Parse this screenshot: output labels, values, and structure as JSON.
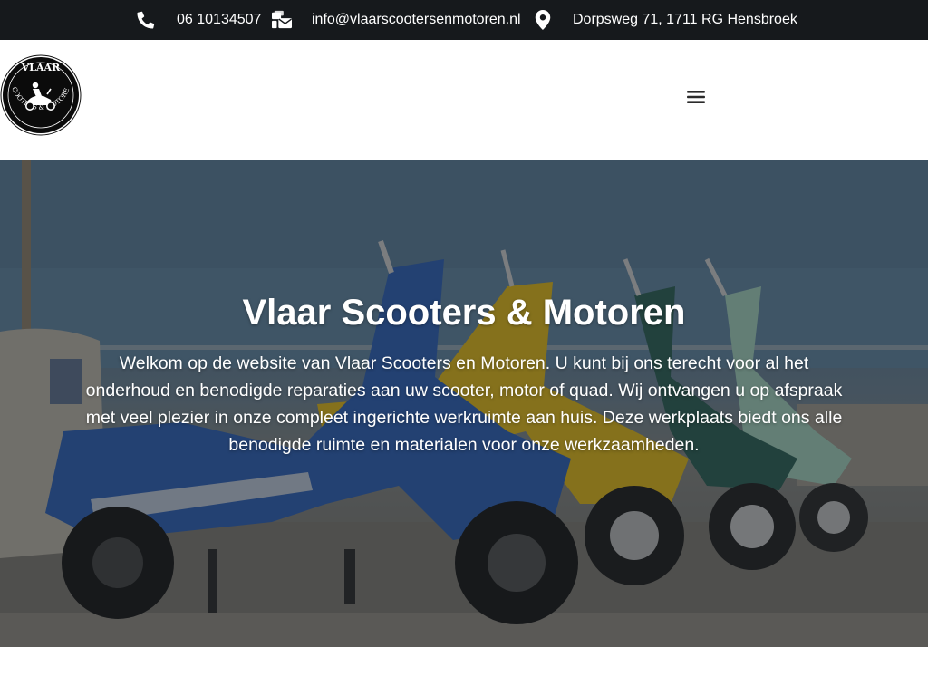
{
  "topbar": {
    "phone": {
      "icon": "phone-icon",
      "text": "06 10134507"
    },
    "email": {
      "icon": "mail-bulk-icon",
      "text": "info@vlaarscootersenmotoren.nl"
    },
    "address": {
      "icon": "map-marker-icon",
      "text": "Dorpsweg 71, 1711 RG Hensbroek"
    },
    "background": "#16191c"
  },
  "header": {
    "logo": {
      "icon": "scooter-rider-icon",
      "top_text": "VLAAR",
      "ring_text": "SCOOTERS & MOTOREN"
    },
    "menu_icon": "hamburger-menu-icon"
  },
  "hero": {
    "title": "Vlaar Scooters & Motoren",
    "text": "Welkom op de website van Vlaar Scooters en Motoren. U kunt bij ons terecht voor al het onderhoud en benodigde reparaties aan uw scooter, motor of quad. Wij ontvangen u op afspraak met veel plezier in onze compleet ingerichte werkruimte aan huis. Deze werkplaats biedt ons alle benodigde ruimte en materialen voor onze werkzaamheden."
  },
  "colors": {
    "accent_dark": "#16191c",
    "text_on_dark": "#ffffff",
    "scooter_blue": "#2f5fb0",
    "scooter_yellow": "#d7b21c",
    "scooter_green": "#2e5f55",
    "scooter_mint": "#9ec9b6"
  }
}
